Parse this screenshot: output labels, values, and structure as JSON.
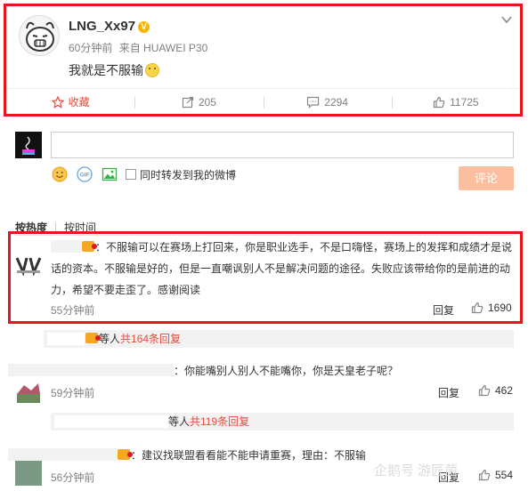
{
  "post": {
    "username": "LNG_Xx97",
    "verified_icon": "v-badge-icon",
    "time": "60分钟前",
    "source": "来自 HUAWEI P30",
    "text": "我就是不服输",
    "emoji": "smile-emoji-icon",
    "actions": {
      "favorite": "收藏",
      "repost": "205",
      "comment": "2294",
      "like": "11725"
    }
  },
  "composer": {
    "placeholder": "",
    "forward_label": "同时转发到我的微博",
    "submit_label": "评论"
  },
  "sort": {
    "hot": "按热度",
    "time": "按时间"
  },
  "comments": [
    {
      "text": "：不服输可以在赛场上打回来，你是职业选手，不是口嗨怪，赛场上的发挥和成绩才是说话的资本。不服输是好的，但是一直嘲讽别人不是解决问题的途径。失败应该带给你的是前进的动力，希望不要走歪了。感谢阅读",
      "time": "55分钟前",
      "reply": "回复",
      "likes": "1690"
    },
    {
      "text": "：你能嘴别人别人不能嘴你，你是天皇老子呢？",
      "time": "59分钟前",
      "reply": "回复",
      "likes": "462"
    },
    {
      "text": "：建议找联盟看看能不能申请重赛，理由：不服输",
      "time": "56分钟前",
      "reply": "回复",
      "likes": "554"
    }
  ],
  "reply_summaries": [
    {
      "prefix": "等人",
      "count": "共164条回复"
    },
    {
      "prefix": "等人",
      "count": "共119条回复"
    }
  ],
  "watermark": "企鹅号 游匠菌",
  "colors": {
    "highlight": "#e5141e",
    "accent": "#e44d3a",
    "button": "#fbbf9f"
  }
}
